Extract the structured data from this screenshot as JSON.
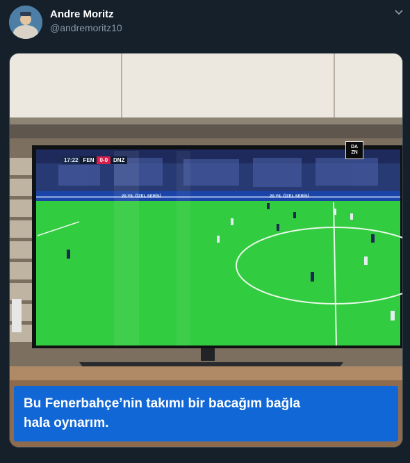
{
  "tweet": {
    "author_name": "Andre Moritz",
    "author_handle": "@andremoritz10",
    "caption_line1": "Bu Fenerbahçe’nin takımı bir bacağım bağla",
    "caption_line2": "hala oynarım."
  },
  "scoreboard": {
    "time": "17:22",
    "home": "FEN",
    "score": "0-0",
    "away": "DNZ"
  },
  "broadcaster": {
    "line1": "DA",
    "line2": "ZN"
  },
  "boards": {
    "left": "20.YIL ÖZEL SERİSİ",
    "right": "20.YIL ÖZEL SERİSİ"
  },
  "colors": {
    "background": "#15202b",
    "caption_bg": "#1167d6",
    "pitch": "#2ecb3d",
    "score_red": "#d8204c"
  },
  "icons": {
    "menu": "chevron-down-icon"
  }
}
